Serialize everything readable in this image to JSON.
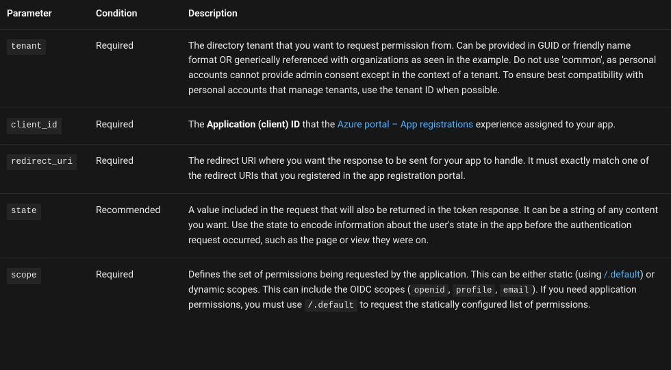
{
  "headers": {
    "parameter": "Parameter",
    "condition": "Condition",
    "description": "Description"
  },
  "rows": [
    {
      "param": "tenant",
      "condition": "Required",
      "desc_plain": "The directory tenant that you want to request permission from. Can be provided in GUID or friendly name format OR generically referenced with organizations as seen in the example. Do not use 'common', as personal accounts cannot provide admin consent except in the context of a tenant. To ensure best compatibility with personal accounts that manage tenants, use the tenant ID when possible."
    },
    {
      "param": "client_id",
      "condition": "Required",
      "desc_prefix": "The ",
      "bold_text": "Application (client) ID",
      "desc_mid": " that the ",
      "link_text": "Azure portal – App registrations",
      "desc_suffix": " experience assigned to your app."
    },
    {
      "param": "redirect_uri",
      "condition": "Required",
      "desc_plain": "The redirect URI where you want the response to be sent for your app to handle. It must exactly match one of the redirect URIs that you registered in the app registration portal."
    },
    {
      "param": "state",
      "condition": "Recommended",
      "desc_plain": "A value included in the request that will also be returned in the token response. It can be a string of any content you want. Use the state to encode information about the user's state in the app before the authentication request occurred, such as the page or view they were on."
    },
    {
      "param": "scope",
      "condition": "Required",
      "scope_part1": "Defines the set of permissions being requested by the application. This can be either static (using ",
      "scope_link": "/.default",
      "scope_part2": ") or dynamic scopes. This can include the OIDC scopes (",
      "scope_code1": "openid",
      "scope_sep": ", ",
      "scope_code2": "profile",
      "scope_code3": "email",
      "scope_part3": "). If you need application permissions, you must use ",
      "scope_code4": "/.default",
      "scope_part4": " to request the statically configured list of permissions."
    }
  ]
}
